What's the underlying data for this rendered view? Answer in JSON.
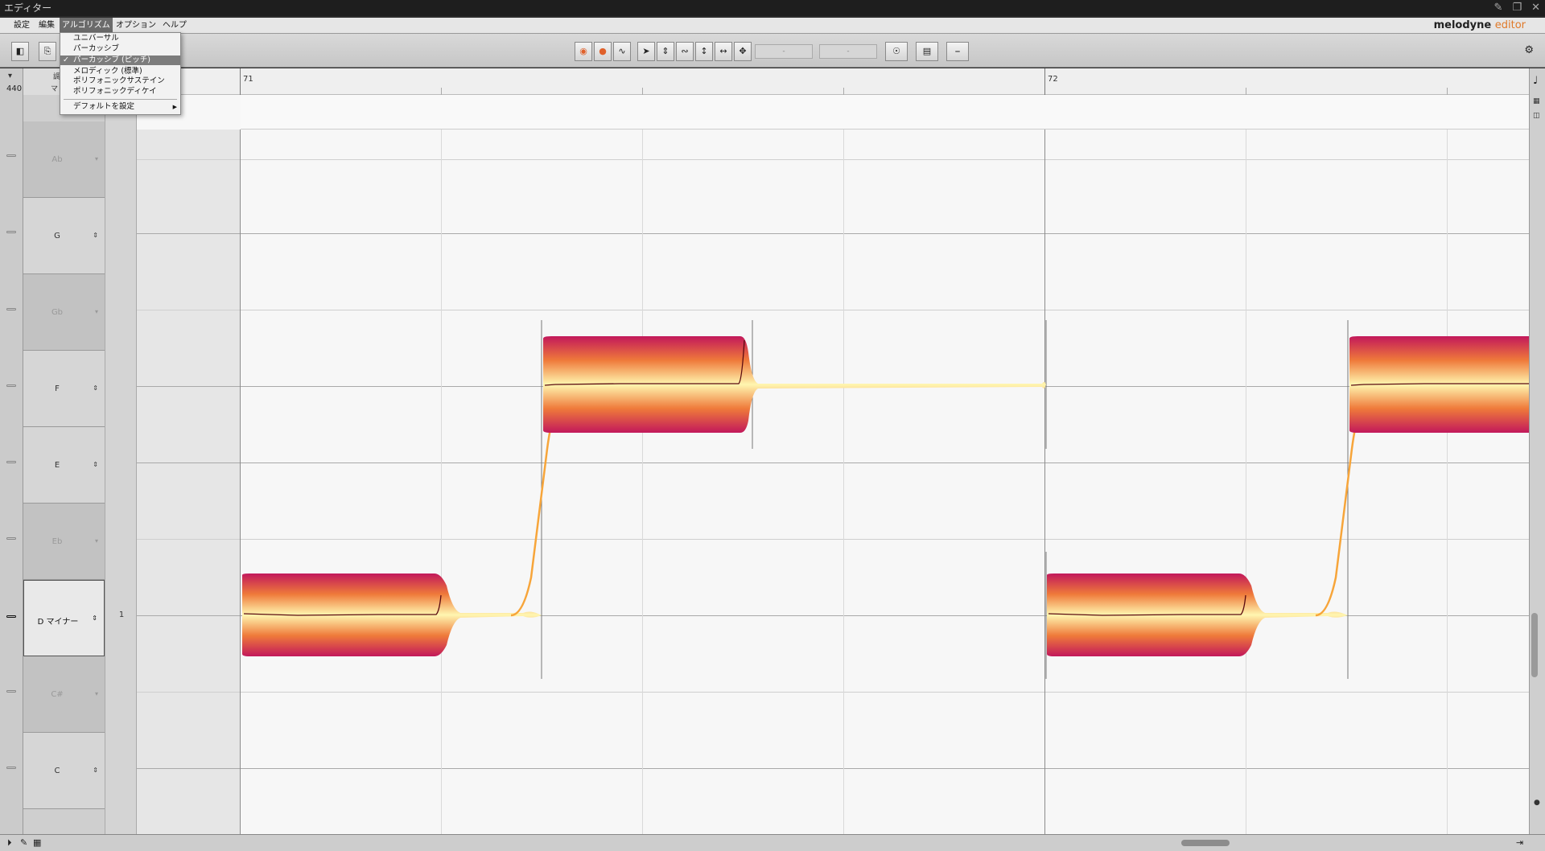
{
  "window": {
    "title": "エディター"
  },
  "menubar": {
    "items": [
      "設定",
      "編集",
      "アルゴリズム",
      "オプション",
      "ヘルプ"
    ],
    "active": "アルゴリズム"
  },
  "brand": {
    "name": "melodyne",
    "edition": "editor"
  },
  "toolbar": {
    "field1": "-",
    "field2": "-"
  },
  "algorithm_menu": {
    "items": [
      "ユニバーサル",
      "パーカッシブ",
      "パーカッシブ (ピッチ)",
      "メロディック (標準)",
      "ポリフォニックサステイン",
      "ポリフォニックディケイ"
    ],
    "checked": "パーカッシブ (ピッチ)",
    "default_label": "デフォルトを設定"
  },
  "tuning": {
    "reference": "440"
  },
  "key_header": {
    "label1": "調",
    "label2": "マ"
  },
  "ruler": {
    "bar1": "71",
    "bar2": "72"
  },
  "pitch_keys": [
    {
      "label": "Ab",
      "type": "black"
    },
    {
      "label": "G",
      "type": "white"
    },
    {
      "label": "Gb",
      "type": "black"
    },
    {
      "label": "F",
      "type": "white"
    },
    {
      "label": "E",
      "type": "white"
    },
    {
      "label": "Eb",
      "type": "black"
    },
    {
      "label": "D マイナー",
      "type": "root"
    },
    {
      "label": "C#",
      "type": "black"
    },
    {
      "label": "C",
      "type": "white"
    }
  ],
  "degree": {
    "root": "1"
  },
  "notes": [
    {
      "bar": 71,
      "beat": 1.0,
      "length_beats": 1.0,
      "pitch": "D"
    },
    {
      "bar": 71,
      "beat": 2.5,
      "length_beats": 1.0,
      "pitch": "F"
    },
    {
      "bar": 72,
      "beat": 1.0,
      "length_beats": 1.0,
      "pitch": "D"
    },
    {
      "bar": 72,
      "beat": 2.5,
      "length_beats": 1.0,
      "pitch": "F"
    }
  ],
  "colors": {
    "blob_edge": "#c2185b",
    "blob_mid": "#fff6b0",
    "pitch_curve": "#f7a53a"
  }
}
